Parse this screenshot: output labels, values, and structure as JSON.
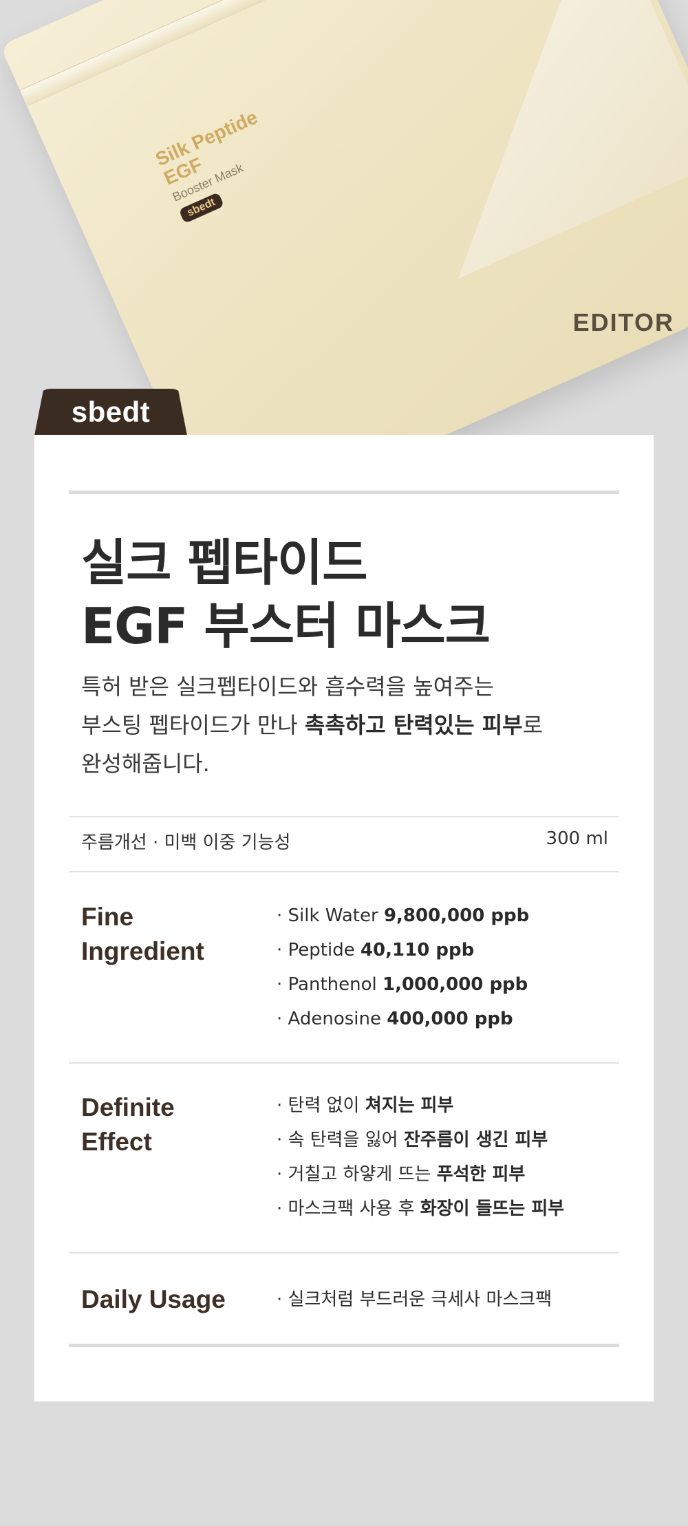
{
  "product_image": {
    "pouch_title_line1": "Silk Peptide",
    "pouch_title_line2": "EGF",
    "pouch_subtitle": "Booster Mask",
    "pouch_chip": "sbedt",
    "pouch_edge_text": "EDITOR"
  },
  "brand_tab": {
    "label": "sbedt"
  },
  "header": {
    "title_line1": "실크 펩타이드",
    "title_line2": "EGF 부스터 마스크"
  },
  "description": {
    "line1": "특허 받은 실크펩타이드와 흡수력을 높여주는",
    "line2_prefix": "부스팅 펩타이드가 만나 ",
    "line2_bold": "촉촉하고 탄력있는 피부",
    "line2_suffix": "로",
    "line3": "완성해줍니다."
  },
  "meta": {
    "function": "주름개선 · 미백 이중 기능성",
    "volume": "300 ml"
  },
  "ingredients": {
    "label_line1": "Fine",
    "label_line2": "Ingredient",
    "items": [
      {
        "name": "· Silk Water  ",
        "amount": "9,800,000 ppb"
      },
      {
        "name": "· Peptide  ",
        "amount": "40,110 ppb"
      },
      {
        "name": "· Panthenol  ",
        "amount": "1,000,000 ppb"
      },
      {
        "name": "· Adenosine ",
        "amount": "400,000 ppb"
      }
    ]
  },
  "effects": {
    "label_line1": "Definite",
    "label_line2": "Effect",
    "items": [
      {
        "text": "· 탄력 없이 ",
        "bold": "쳐지는 피부"
      },
      {
        "text": "· 속 탄력을 잃어 ",
        "bold": "잔주름이 생긴 피부"
      },
      {
        "text": "· 거칠고 하얗게 뜨는 ",
        "bold": "푸석한 피부"
      },
      {
        "text": "· 마스크팩 사용 후 ",
        "bold": "화장이 들뜨는 피부"
      }
    ]
  },
  "usage": {
    "label": "Daily Usage",
    "text": "· 실크처럼 부드러운 극세사 마스크팩"
  }
}
